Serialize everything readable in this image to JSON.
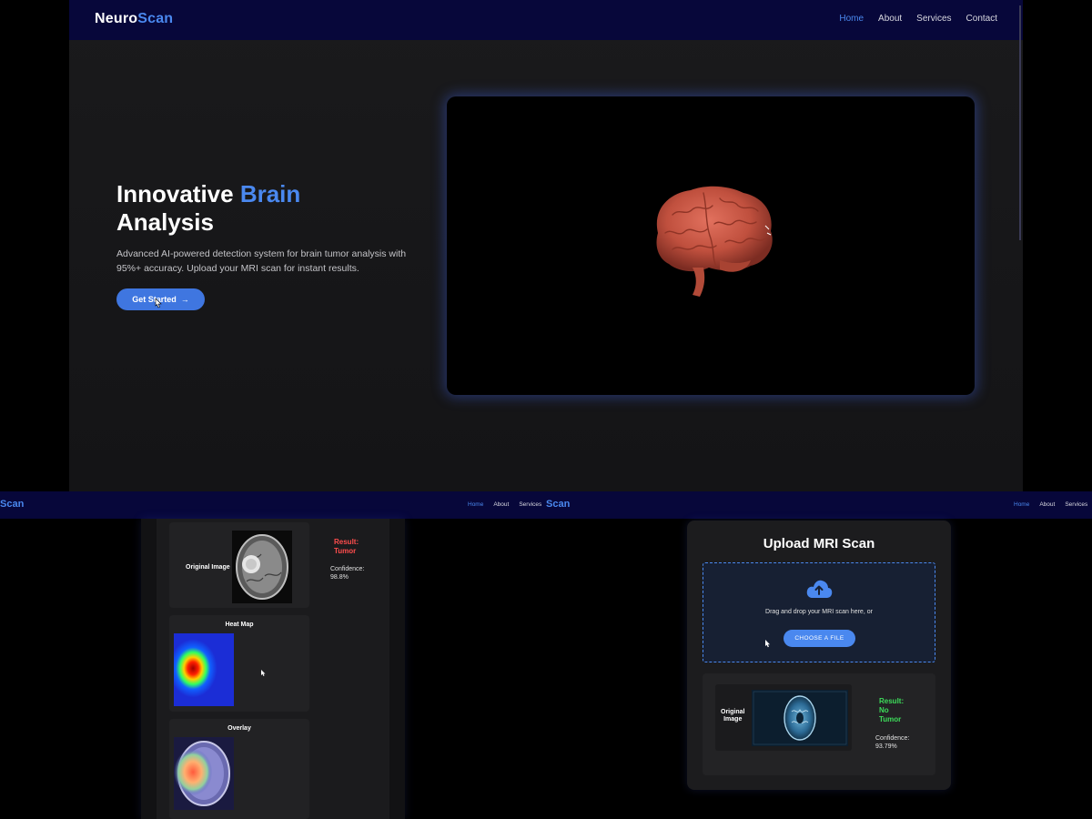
{
  "top": {
    "logo": {
      "part1": "Neuro",
      "part2": "Scan"
    },
    "nav": [
      "Home",
      "About",
      "Services",
      "Contact"
    ],
    "hero": {
      "title_part1": "Innovative ",
      "title_highlight": "Brain",
      "title_part2": "Analysis",
      "description": "Advanced AI-powered detection system for brain tumor analysis with 95%+ accuracy. Upload your MRI scan for instant results.",
      "cta_label": "Get Started",
      "cta_arrow": "→"
    }
  },
  "bottom_left_nav": {
    "logo_fragment": "Scan",
    "links": [
      "Home",
      "About",
      "Services"
    ]
  },
  "bottom_right_nav": {
    "logo_fragment": "Scan",
    "links": [
      "Home",
      "About",
      "Services"
    ]
  },
  "analysis_panel": {
    "original_label": "Original Image",
    "result_label": "Result:",
    "result_value": "Tumor",
    "confidence_label": "Confidence:",
    "confidence_value": "98.8%",
    "heatmap_label": "Heat Map",
    "overlay_label": "Overlay"
  },
  "upload_panel": {
    "title": "Upload MRI Scan",
    "drop_text": "Drag and drop your MRI scan here, or",
    "choose_label": "CHOOSE A FILE",
    "original_label_line1": "Original",
    "original_label_line2": "Image",
    "result_line1": "Result:",
    "result_line2": "No",
    "result_line3": "Tumor",
    "confidence_label": "Confidence:",
    "confidence_value": "93.79%"
  },
  "colors": {
    "accent": "#4a88ef",
    "nav_bg": "#07073a",
    "tumor_red": "#ff4d4d",
    "no_tumor_green": "#3ddc5a"
  }
}
